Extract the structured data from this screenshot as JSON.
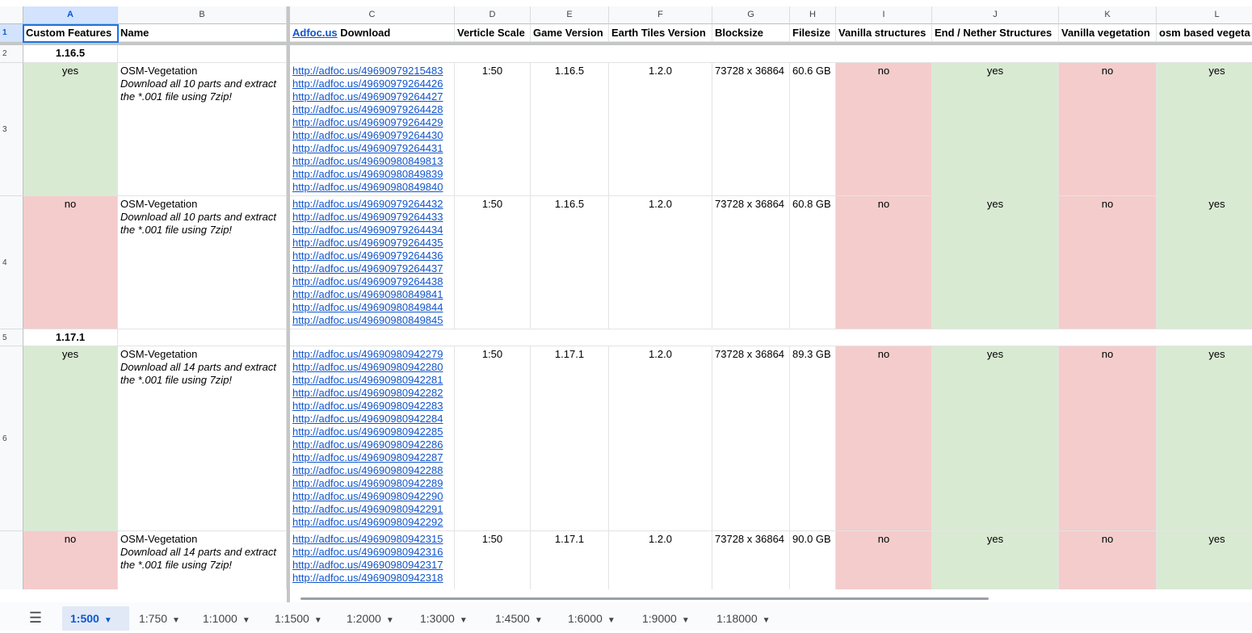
{
  "columns": {
    "A": "A",
    "B": "B",
    "C": "C",
    "D": "D",
    "E": "E",
    "F": "F",
    "G": "G",
    "H": "H",
    "I": "I",
    "J": "J",
    "K": "K",
    "L": "L"
  },
  "row_numbers": [
    "1",
    "2",
    "3",
    "4",
    "5",
    "6"
  ],
  "header": {
    "custom_features": "Custom Features",
    "name": "Name",
    "download_link": "Adfoc.us",
    "download_suffix": " Download",
    "scale": "Verticle Scale",
    "game_version": "Game Version",
    "earth_tiles": "Earth Tiles Version",
    "blocksize": "Blocksize",
    "filesize": "Filesize",
    "vanilla_structures": "Vanilla structures",
    "end_nether": "End / Nether Structures",
    "vanilla_vegetation": "Vanilla vegetation",
    "osm_vegetation": "osm based vegeta"
  },
  "groups": {
    "g1": "1.16.5",
    "g2": "1.17.1"
  },
  "rows": [
    {
      "custom": "yes",
      "name": "OSM-Vegetation",
      "note": "Download all 10 parts and extract the *.001 file using 7zip!",
      "links": [
        "http://adfoc.us/49690979215483",
        "http://adfoc.us/49690979264426",
        "http://adfoc.us/49690979264427",
        "http://adfoc.us/49690979264428",
        "http://adfoc.us/49690979264429",
        "http://adfoc.us/49690979264430",
        "http://adfoc.us/49690979264431",
        "http://adfoc.us/49690980849813",
        "http://adfoc.us/49690980849839",
        "http://adfoc.us/49690980849840"
      ],
      "scale": "1:50",
      "game": "1.16.5",
      "tiles": "1.2.0",
      "block": "73728 x 36864",
      "size": "60.6 GB",
      "vs": "no",
      "en": "yes",
      "vv": "no",
      "osm": "yes"
    },
    {
      "custom": "no",
      "name": "OSM-Vegetation",
      "note": "Download all 10 parts and extract the *.001 file using 7zip!",
      "links": [
        "http://adfoc.us/49690979264432",
        "http://adfoc.us/49690979264433",
        "http://adfoc.us/49690979264434",
        "http://adfoc.us/49690979264435",
        "http://adfoc.us/49690979264436",
        "http://adfoc.us/49690979264437",
        "http://adfoc.us/49690979264438",
        "http://adfoc.us/49690980849841",
        "http://adfoc.us/49690980849844",
        "http://adfoc.us/49690980849845"
      ],
      "scale": "1:50",
      "game": "1.16.5",
      "tiles": "1.2.0",
      "block": "73728 x 36864",
      "size": "60.8 GB",
      "vs": "no",
      "en": "yes",
      "vv": "no",
      "osm": "yes"
    },
    {
      "custom": "yes",
      "name": "OSM-Vegetation",
      "note": "Download all 14 parts and extract the *.001 file using 7zip!",
      "links": [
        "http://adfoc.us/49690980942279",
        "http://adfoc.us/49690980942280",
        "http://adfoc.us/49690980942281",
        "http://adfoc.us/49690980942282",
        "http://adfoc.us/49690980942283",
        "http://adfoc.us/49690980942284",
        "http://adfoc.us/49690980942285",
        "http://adfoc.us/49690980942286",
        "http://adfoc.us/49690980942287",
        "http://adfoc.us/49690980942288",
        "http://adfoc.us/49690980942289",
        "http://adfoc.us/49690980942290",
        "http://adfoc.us/49690980942291",
        "http://adfoc.us/49690980942292"
      ],
      "scale": "1:50",
      "game": "1.17.1",
      "tiles": "1.2.0",
      "block": "73728 x 36864",
      "size": "89.3 GB",
      "vs": "no",
      "en": "yes",
      "vv": "no",
      "osm": "yes"
    },
    {
      "custom": "no",
      "name": "OSM-Vegetation",
      "note": "Download all 14 parts and extract the *.001 file using 7zip!",
      "links": [
        "http://adfoc.us/49690980942315",
        "http://adfoc.us/49690980942316",
        "http://adfoc.us/49690980942317",
        "http://adfoc.us/49690980942318"
      ],
      "scale": "1:50",
      "game": "1.17.1",
      "tiles": "1.2.0",
      "block": "73728 x 36864",
      "size": "90.0 GB",
      "vs": "no",
      "en": "yes",
      "vv": "no",
      "osm": "yes"
    }
  ],
  "tabs": [
    "1:500",
    "1:750",
    "1:1000",
    "1:1500",
    "1:2000",
    "1:3000",
    "1:4500",
    "1:6000",
    "1:9000",
    "1:18000"
  ],
  "colors": {
    "green": "#d9ead3",
    "red": "#f4cccc",
    "accent": "#0b57d0",
    "link": "#1155cc"
  }
}
